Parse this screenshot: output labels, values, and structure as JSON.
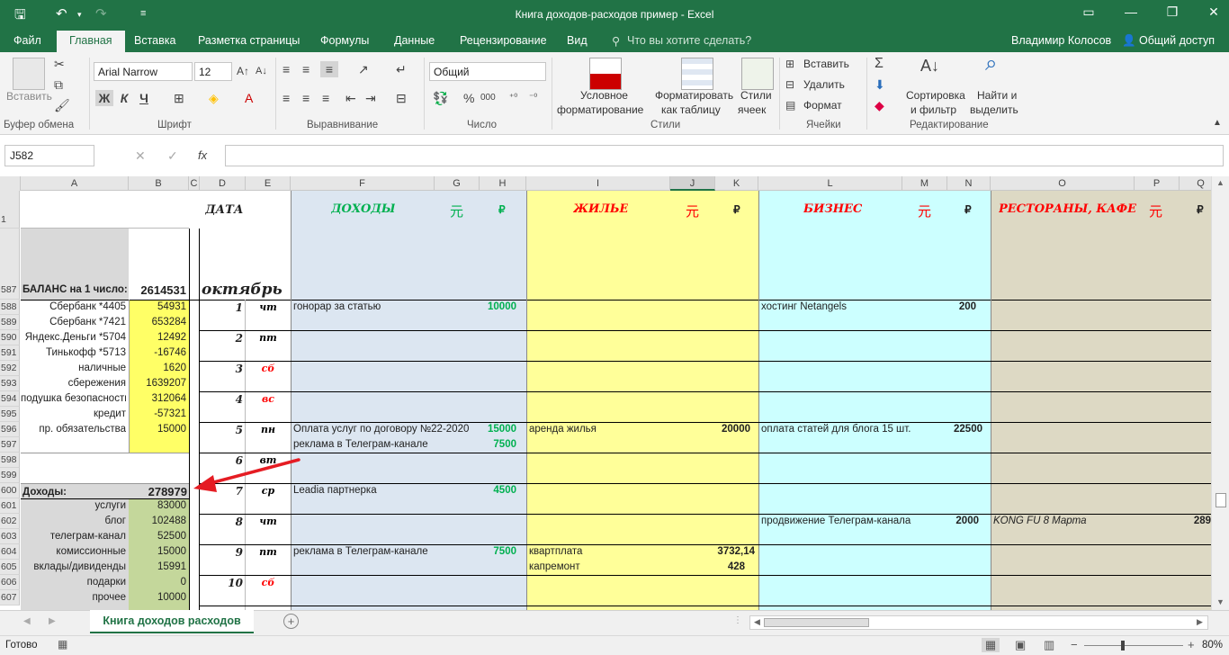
{
  "window": {
    "title": "Книга доходов-расходов пример - Excel",
    "user": "Владимир Колосов",
    "share": "Общий доступ"
  },
  "ribbon_tabs": [
    "Файл",
    "Главная",
    "Вставка",
    "Разметка страницы",
    "Формулы",
    "Данные",
    "Рецензирование",
    "Вид"
  ],
  "tell_me": "Что вы хотите сделать?",
  "ribbon": {
    "paste": "Вставить",
    "clipboard": "Буфер обмена",
    "font_name": "Arial Narrow",
    "font_size": "12",
    "bold": "Ж",
    "italic": "К",
    "underline": "Ч",
    "font_group": "Шрифт",
    "align_group": "Выравнивание",
    "number_format": "Общий",
    "percent": "%",
    "thousands": "000",
    "number_group": "Число",
    "cond_format_1": "Условное",
    "cond_format_2": "форматирование",
    "format_table_1": "Форматировать",
    "format_table_2": "как таблицу",
    "cell_styles_1": "Стили",
    "cell_styles_2": "ячеек",
    "styles_group": "Стили",
    "insert": "Вставить",
    "delete": "Удалить",
    "format": "Формат",
    "cells_group": "Ячейки",
    "sort_1": "Сортировка",
    "sort_2": "и фильтр",
    "find_1": "Найти и",
    "find_2": "выделить",
    "editing_group": "Редактирование"
  },
  "name_box": "J582",
  "fx": "fx",
  "columns": [
    "A",
    "B",
    "C",
    "D",
    "E",
    "F",
    "G",
    "H",
    "I",
    "J",
    "K",
    "L",
    "M",
    "N",
    "O",
    "P",
    "Q"
  ],
  "headers": {
    "date": "ДАТА",
    "income": "ДОХОДЫ",
    "housing": "ЖИЛЬЕ",
    "business": "БИЗНЕС",
    "restaurants": "РЕСТОРАНЫ, КАФЕ",
    "yuan": "元",
    "rub": "₽"
  },
  "row_numbers": [
    "1",
    "587",
    "588",
    "589",
    "590",
    "591",
    "592",
    "593",
    "594",
    "595",
    "596",
    "597",
    "598",
    "599",
    "600",
    "601",
    "602",
    "603",
    "604",
    "605",
    "606",
    "607"
  ],
  "balance": {
    "label": "БАЛАНС на 1 число:",
    "value": "2614531",
    "month": "октябрь"
  },
  "accounts": [
    {
      "name": "Сбербанк *4405",
      "value": "54931"
    },
    {
      "name": "Сбербанк *7421",
      "value": "653284"
    },
    {
      "name": "Яндекс.Деньги *5704",
      "value": "12492"
    },
    {
      "name": "Тинькофф *5713",
      "value": "-16746"
    },
    {
      "name": "наличные",
      "value": "1620"
    },
    {
      "name": "сбережения",
      "value": "1639207"
    },
    {
      "name": "подушка безопасности",
      "value": "312064"
    },
    {
      "name": "кредит",
      "value": "-57321"
    },
    {
      "name": "пр. обязательства",
      "value": "15000"
    }
  ],
  "income_summary": {
    "label": "Доходы:",
    "value": "278979"
  },
  "income_items": [
    {
      "name": "услуги",
      "value": "83000"
    },
    {
      "name": "блог",
      "value": "102488"
    },
    {
      "name": "телеграм-канал",
      "value": "52500"
    },
    {
      "name": "комиссионные",
      "value": "15000"
    },
    {
      "name": "вклады/дивиденды",
      "value": "15991"
    },
    {
      "name": "подарки",
      "value": "0"
    },
    {
      "name": "прочее",
      "value": "10000"
    }
  ],
  "days": [
    {
      "num": "1",
      "dow": "чт"
    },
    {
      "num": "2",
      "dow": "пт"
    },
    {
      "num": "3",
      "dow": "сб"
    },
    {
      "num": "4",
      "dow": "вс"
    },
    {
      "num": "5",
      "dow": "пн"
    },
    {
      "num": "6",
      "dow": "вт"
    },
    {
      "num": "7",
      "dow": "ср"
    },
    {
      "num": "8",
      "dow": "чт"
    },
    {
      "num": "9",
      "dow": "пт"
    },
    {
      "num": "10",
      "dow": "сб"
    }
  ],
  "entries": {
    "income": [
      {
        "text": "гонорар за статью",
        "value": "10000"
      },
      {
        "text": "Оплата услуг по договору №22-2020",
        "value": "15000"
      },
      {
        "text": "реклама в Телеграм-канале",
        "value": "7500"
      },
      {
        "text": "Leadia партнерка",
        "value": "4500"
      },
      {
        "text": "реклама в Телеграм-канале",
        "value": "7500"
      }
    ],
    "housing": [
      {
        "text": "аренда жилья",
        "value": "20000"
      },
      {
        "text": "квартплата",
        "value": "3732,14"
      },
      {
        "text": "капремонт",
        "value": "428"
      }
    ],
    "business": [
      {
        "text": "хостинг Netangels",
        "value": "200"
      },
      {
        "text": "оплата статей для блога 15 шт.",
        "value": "22500"
      },
      {
        "text": "продвижение Телеграм-канала",
        "value": "2000"
      }
    ],
    "restaurants": [
      {
        "text": "KONG FU 8 Марта",
        "value": "289"
      }
    ]
  },
  "sheet_tab": "Книга доходов расходов",
  "status": {
    "ready": "Готово",
    "zoom": "80%"
  },
  "colors": {
    "excel_green": "#217346",
    "income_bg": "#dce6f1",
    "housing_bg": "#ffff99",
    "business_bg": "#ccffff",
    "restaurant_bg": "#ddd9c4",
    "account_yellow": "#ffff66",
    "income_items_green": "#c4d79b",
    "income_text": "#00b050",
    "red_text": "#ff0000"
  }
}
